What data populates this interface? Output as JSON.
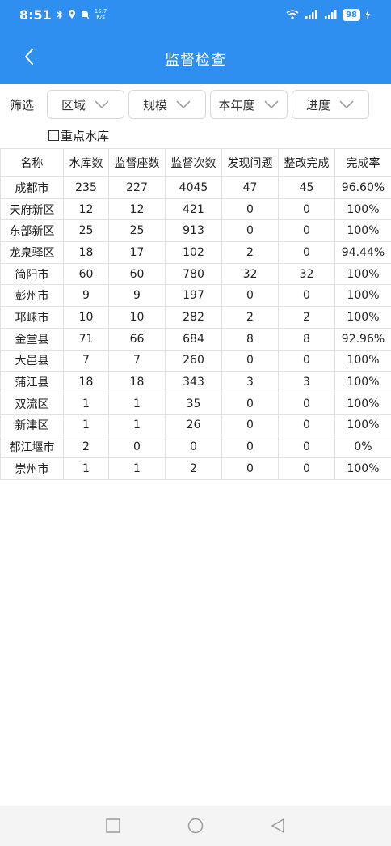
{
  "status_bar": {
    "time": "8:51",
    "speed_value": "15.7",
    "speed_unit": "K/s",
    "battery": "98",
    "icons": [
      "bluetooth-icon",
      "location-icon",
      "mute-icon",
      "wifi-icon",
      "signal-icon",
      "signal-icon",
      "charging-icon"
    ]
  },
  "header": {
    "title": "监督检查",
    "back_icon": "back-arrow-icon",
    "background_color": "#2e8ff0"
  },
  "filters": {
    "label": "筛选",
    "options": [
      "区域",
      "规模",
      "本年度",
      "进度"
    ]
  },
  "checkbox": {
    "label": "重点水库",
    "checked": false
  },
  "table": {
    "columns": [
      "名称",
      "水库数",
      "监督座数",
      "监督次数",
      "发现问题",
      "整改完成",
      "完成率"
    ],
    "rows": [
      [
        "成都市",
        "235",
        "227",
        "4045",
        "47",
        "45",
        "96.60%"
      ],
      [
        "天府新区",
        "12",
        "12",
        "421",
        "0",
        "0",
        "100%"
      ],
      [
        "东部新区",
        "25",
        "25",
        "913",
        "0",
        "0",
        "100%"
      ],
      [
        "龙泉驿区",
        "18",
        "17",
        "102",
        "2",
        "0",
        "94.44%"
      ],
      [
        "简阳市",
        "60",
        "60",
        "780",
        "32",
        "32",
        "100%"
      ],
      [
        "彭州市",
        "9",
        "9",
        "197",
        "0",
        "0",
        "100%"
      ],
      [
        "邛崃市",
        "10",
        "10",
        "282",
        "2",
        "2",
        "100%"
      ],
      [
        "金堂县",
        "71",
        "66",
        "684",
        "8",
        "8",
        "92.96%"
      ],
      [
        "大邑县",
        "7",
        "7",
        "260",
        "0",
        "0",
        "100%"
      ],
      [
        "蒲江县",
        "18",
        "18",
        "343",
        "3",
        "3",
        "100%"
      ],
      [
        "双流区",
        "1",
        "1",
        "35",
        "0",
        "0",
        "100%"
      ],
      [
        "新津区",
        "1",
        "1",
        "26",
        "0",
        "0",
        "100%"
      ],
      [
        "都江堰市",
        "2",
        "0",
        "0",
        "0",
        "0",
        "0%"
      ],
      [
        "崇州市",
        "1",
        "1",
        "2",
        "0",
        "0",
        "100%"
      ]
    ]
  },
  "system_nav": {
    "icons": [
      "recent-apps-icon",
      "home-icon",
      "back-icon"
    ]
  }
}
